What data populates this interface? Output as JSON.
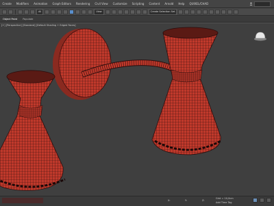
{
  "menubar": {
    "items": [
      "Create",
      "Modifiers",
      "Animation",
      "Graph Editors",
      "Rendering",
      "Civil View",
      "Customize",
      "Scripting",
      "Content",
      "Arnold",
      "Help",
      "QUIXEL/CHAD"
    ],
    "search_placeholder": "Sign In"
  },
  "toolbar": {
    "selection_filter": "All",
    "named_selection": "Create Selection Set",
    "coordinate_system": "View"
  },
  "ribbon": {
    "tabs": [
      "Object Paint",
      "Populate"
    ]
  },
  "viewport": {
    "label": "[+] [Perspective] [Standard] [Default Shading + Edged Faces]",
    "object_color": "#c0392b",
    "wire_color": "#1a0a0a"
  },
  "statusbar": {
    "x_label": "X:",
    "y_label": "Y:",
    "z_label": "Z:",
    "grid": "Grid = 10,0cm",
    "add_time_tag": "Add Time Tag",
    "auto": "Auto",
    "set_key": "Set K."
  }
}
